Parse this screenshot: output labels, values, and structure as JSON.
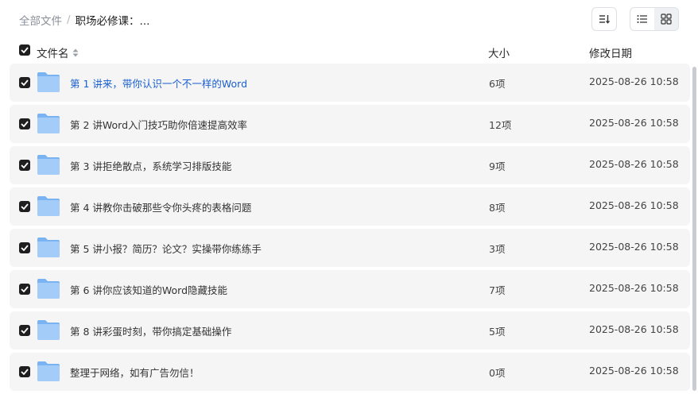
{
  "breadcrumb": {
    "root": "全部文件",
    "separator": "/",
    "current": "职场必修课：..."
  },
  "columns": {
    "name": "文件名",
    "size": "大小",
    "date": "修改日期"
  },
  "colors": {
    "folder": "#8ec0f5",
    "link": "#1a5fd0",
    "row_bg": "#f5f5f6"
  },
  "icons": {
    "sort": "sort-icon",
    "list_view": "list-view-icon",
    "grid_view": "grid-view-icon",
    "folder": "folder-icon"
  },
  "files": [
    {
      "name": "第 1 讲来，带你认识一个不一样的Word",
      "size": "6项",
      "date": "2025-08-26 10:58"
    },
    {
      "name": "第 2 讲Word入门技巧助你倍速提高效率",
      "size": "12项",
      "date": "2025-08-26 10:58"
    },
    {
      "name": "第 3 讲拒绝散点，系统学习排版技能",
      "size": "9项",
      "date": "2025-08-26 10:58"
    },
    {
      "name": "第 4 讲教你击破那些令你头疼的表格问题",
      "size": "8项",
      "date": "2025-08-26 10:58"
    },
    {
      "name": "第 5 讲小报？简历？论文？实操带你练练手",
      "size": "3项",
      "date": "2025-08-26 10:58"
    },
    {
      "name": "第 6 讲你应该知道的Word隐藏技能",
      "size": "7项",
      "date": "2025-08-26 10:58"
    },
    {
      "name": "第 8 讲彩蛋时刻，带你搞定基础操作",
      "size": "5项",
      "date": "2025-08-26 10:58"
    },
    {
      "name": "整理于网络，如有广告勿信！",
      "size": "0项",
      "date": "2025-08-26 10:58"
    }
  ]
}
